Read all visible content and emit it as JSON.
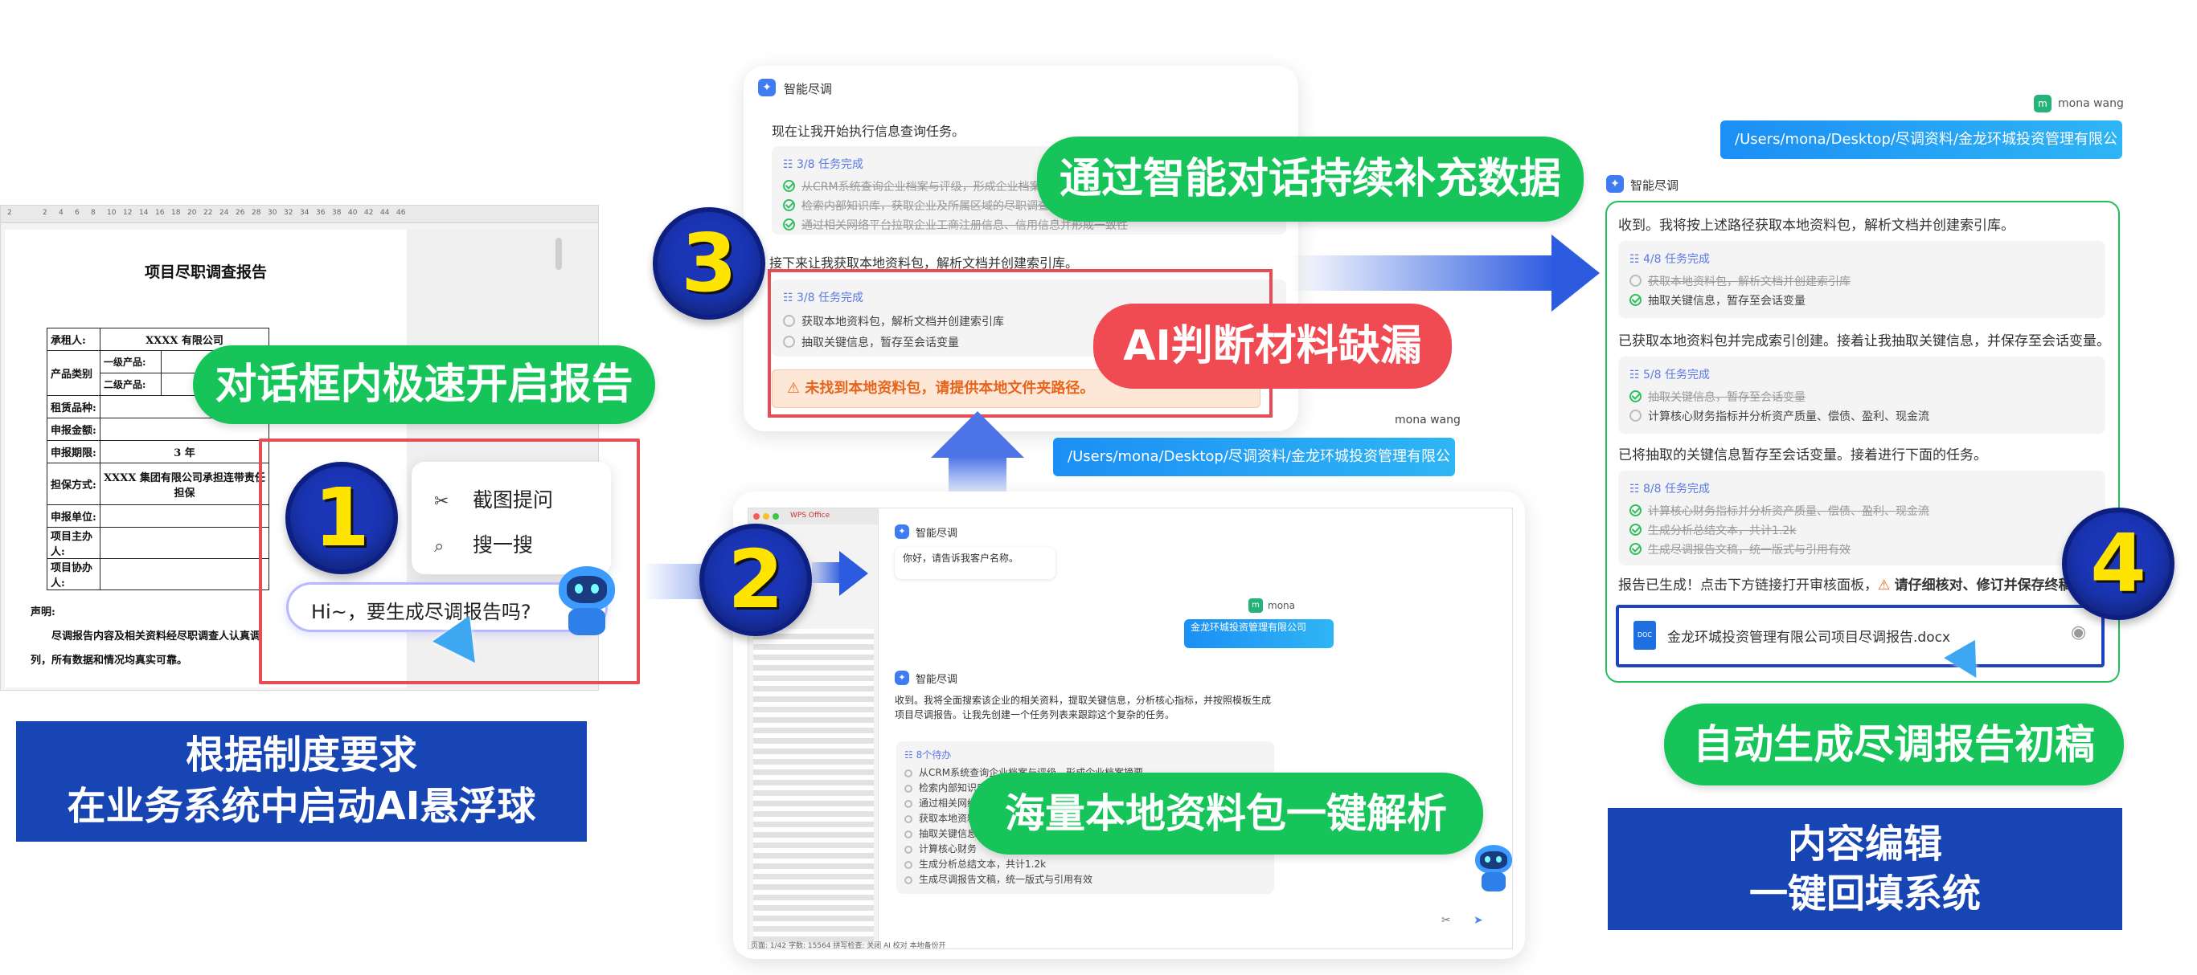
{
  "step1": {
    "number": "1",
    "ruler_ticks": [
      "2",
      "2",
      "4",
      "6",
      "8",
      "10",
      "12",
      "14",
      "16",
      "18",
      "20",
      "22",
      "24",
      "26",
      "28",
      "30",
      "32",
      "34",
      "36",
      "38",
      "40",
      "42",
      "44",
      "46"
    ],
    "doc_title": "项目尽职调查报告",
    "table": {
      "row1_label": "承租人:",
      "row1_value": "XXXX 有限公司",
      "row2_label": "产品类别",
      "row2_sub1": "一级产品:",
      "row2_sub2": "二级产品:",
      "row3_label": "租赁品种:",
      "row4_label": "申报金额:",
      "row5_label": "申报期限:",
      "row5_value": "3 年",
      "row6_label": "担保方式:",
      "row6_value": "XXXX 集团有限公司承担连带责任担保",
      "row7_label": "申报单位:",
      "row8_label": "项目主办人:",
      "row9_label": "项目协办人:"
    },
    "decl_title": "声明:",
    "decl_text": "尽调报告内容及相关资料经尽职调查人认真调查核实，所有数据和情况均真实可靠。",
    "decl_text_line1": "尽调报告内容及相关资料经尽职调查人认真调",
    "decl_text_line2": "列，所有数据和情况均真实可靠。",
    "menu_screenshot": "截图提问",
    "menu_search": "搜一搜",
    "hi_text": "Hi~，要生成尽调报告吗?",
    "pill": "对话框内极速开启报告",
    "caption_line1": "根据制度要求",
    "caption_line2": "在业务系统中启动AI悬浮球"
  },
  "step2": {
    "number": "2",
    "tab_app": "WPS Office",
    "assistant_name": "智能尽调",
    "greeting": "你好，请告诉我客户名称。",
    "user_name": "mona",
    "user_msg": "金龙环城投资管理有限公司",
    "reply": "收到。我将全面搜索该企业的相关资料，提取关键信息，分析核心指标，并按照模板生成项目尽调报告。让我先创建一个任务列表来跟踪这个复杂的任务。",
    "task_head": "8个待办",
    "tasks": [
      "从CRM系统查询企业档案与评级，形成企业档案摘要",
      "检索内部知识库",
      "通过相关网络平台",
      "获取本地资料包",
      "抽取关键信息",
      "计算核心财务",
      "生成分析总结文本，共计1.2k",
      "生成尽调报告文稿，统一版式与引用有效"
    ],
    "status_bar": "页面: 1/42   字数: 15564   拼写检查: 关闭   AI 校对   本地备份开",
    "pill": "海量本地资料包一键解析"
  },
  "step3": {
    "number": "3",
    "assistant_name": "智能尽调",
    "intro": "现在让我开始执行信息查询任务。",
    "box1_head": "3/8 任务完成",
    "box1_tasks": [
      "从CRM系统查询企业档案与评级，形成企业档案摘要",
      "检索内部知识库，获取企业及所属区域的尽职调查记录",
      "通过相关网络平台拉取企业工商注册信息、信用信息并形成一致性"
    ],
    "next_line": "接下来让我获取本地资料包，解析文档并创建索引库。",
    "box2_head": "3/8 任务完成",
    "box2_tasks": [
      "获取本地资料包，解析文档并创建索引库",
      "抽取关键信息，暂存至会话变量"
    ],
    "warning": "未找到本地资料包，请提供本地文件夹路径。",
    "pill": "通过智能对话持续补充数据",
    "red_pill": "AI判断材料缺漏",
    "user_name": "mona wang",
    "user_path": "/Users/mona/Desktop/尽调资料/金龙环城投资管理有限公司"
  },
  "step4": {
    "number": "4",
    "user_name": "mona wang",
    "user_path": "/Users/mona/Desktop/尽调资料/金龙环城投资管理有限公司",
    "assistant_name": "智能尽调",
    "line1": "收到。我将按上述路径获取本地资料包，解析文档并创建索引库。",
    "box1_head": "4/8 任务完成",
    "box1_tasks": [
      "获取本地资料包，解析文档并创建索引库",
      "抽取关键信息，暂存至会话变量"
    ],
    "line2": "已获取本地资料包并完成索引创建。接着让我抽取关键信息，并保存至会话变量。",
    "box2_head": "5/8 任务完成",
    "box2_tasks": [
      "抽取关键信息，暂存至会话变量",
      "计算核心财务指标并分析资产质量、偿债、盈利、现金流"
    ],
    "line3": "已将抽取的关键信息暂存至会话变量。接着进行下面的任务。",
    "box3_head": "8/8 任务完成",
    "box3_tasks": [
      "计算核心财务指标并分析资产质量、偿债、盈利、现金流",
      "生成分析总结文本，共计1.2k",
      "生成尽调报告文稿，统一版式与引用有效"
    ],
    "line4_a": "报告已生成！点击下方链接打开审核面板，",
    "line4_b": "请仔细核对、修订并保存终稿。",
    "docx_name": "金龙环城投资管理有限公司项目尽调报告.docx",
    "pill": "自动生成尽调报告初稿",
    "caption_line1": "内容编辑",
    "caption_line2": "一键回填系统"
  },
  "colors": {
    "green": "#16c45a",
    "red": "#f04a52",
    "blue": "#1745b4",
    "badge_yellow": "#ffe400"
  }
}
